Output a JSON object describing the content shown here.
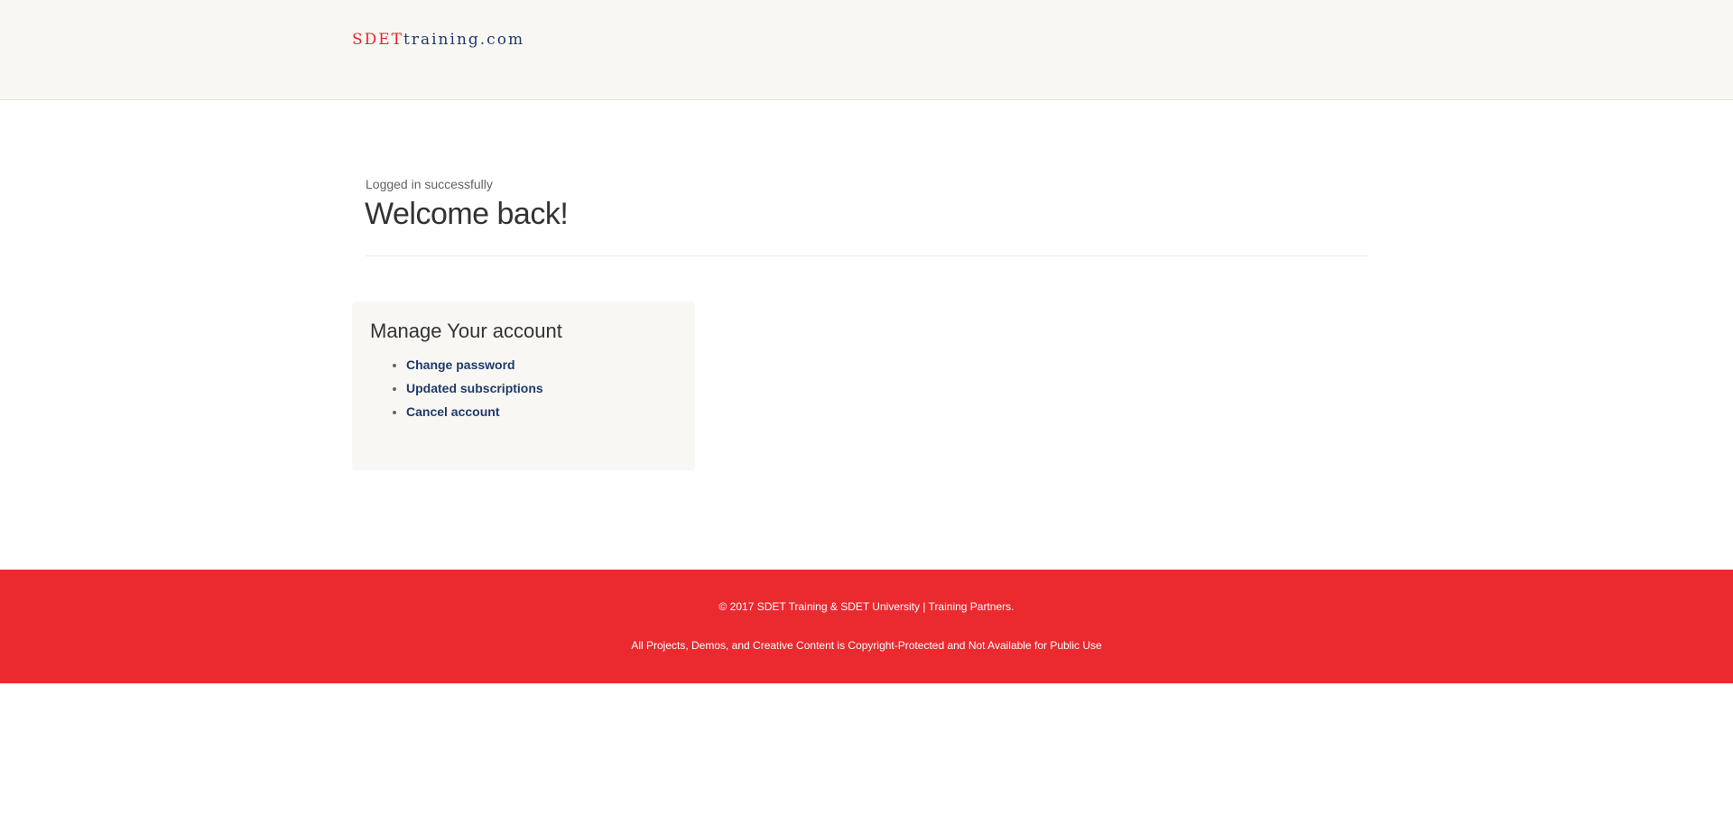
{
  "header": {
    "logo_part1": "SDET",
    "logo_part2": "training.com"
  },
  "main": {
    "status_message": "Logged in successfully",
    "heading": "Welcome back!"
  },
  "account": {
    "title": "Manage Your account",
    "links": [
      {
        "label": "Change password"
      },
      {
        "label": "Updated subscriptions"
      },
      {
        "label": "Cancel account"
      }
    ]
  },
  "footer": {
    "copyright": "© 2017 SDET Training & SDET University | Training Partners.",
    "notice": "All Projects, Demos, and Creative Content is Copyright-Protected and Not Available for Public Use"
  },
  "colors": {
    "brand_red": "#e9242b",
    "brand_navy": "#243a6b",
    "footer_bg": "#eb2a30",
    "panel_bg": "#f8f7f3"
  }
}
